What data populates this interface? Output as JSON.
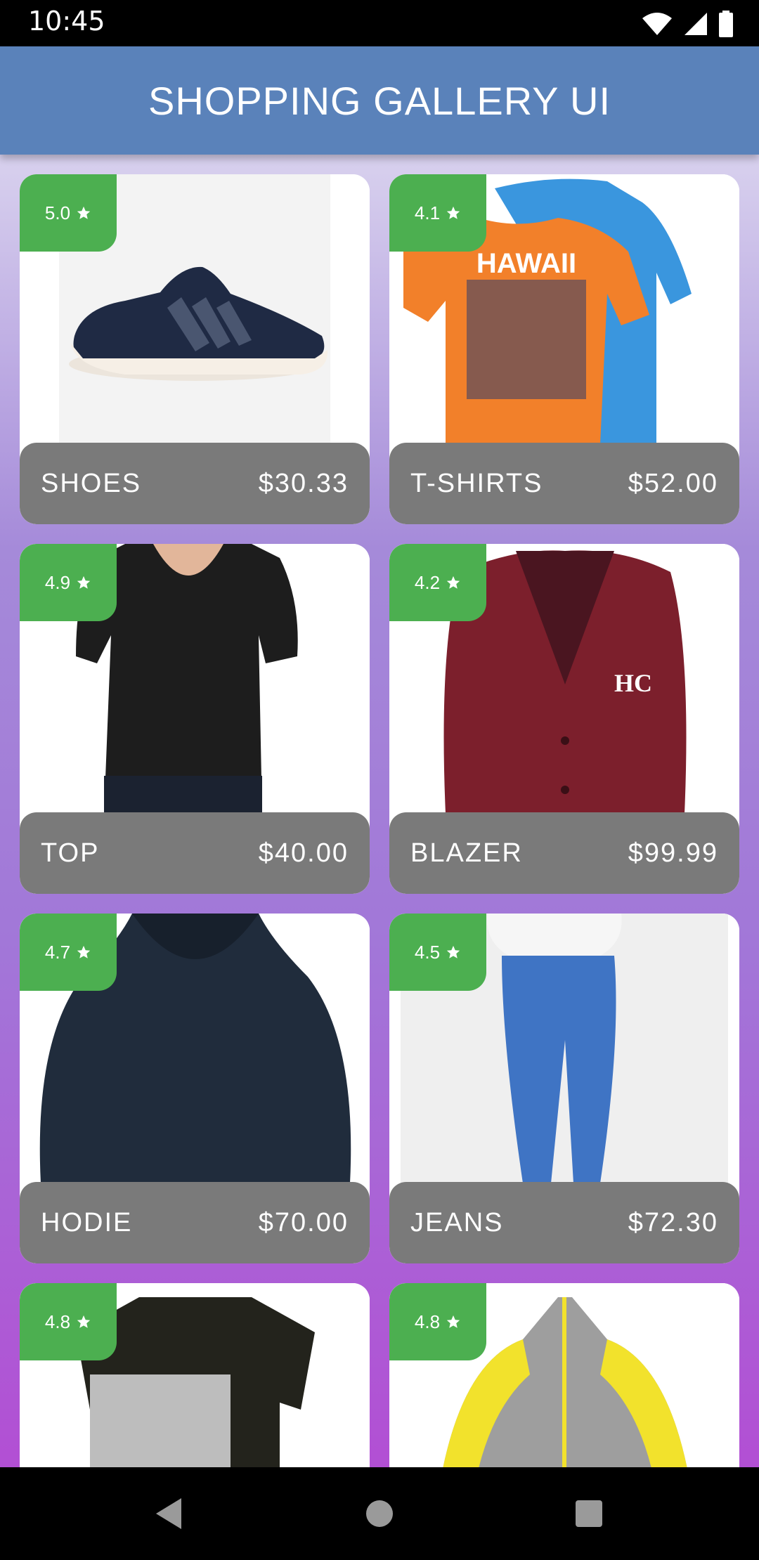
{
  "status": {
    "time": "10:45"
  },
  "appbar": {
    "title": "SHOPPING GALLERY UI"
  },
  "products": [
    {
      "name": "SHOES",
      "price": "$30.33",
      "rating": "5.0",
      "icon": "sneaker-image"
    },
    {
      "name": "T-SHIRTS",
      "price": "$52.00",
      "rating": "4.1",
      "icon": "tshirts-image"
    },
    {
      "name": "TOP",
      "price": "$40.00",
      "rating": "4.9",
      "icon": "black-top-image"
    },
    {
      "name": "BLAZER",
      "price": "$99.99",
      "rating": "4.2",
      "icon": "maroon-blazer-image"
    },
    {
      "name": "HODIE",
      "price": "$70.00",
      "rating": "4.7",
      "icon": "navy-hoodie-image"
    },
    {
      "name": "JEANS",
      "price": "$72.30",
      "rating": "4.5",
      "icon": "blue-jeans-image"
    },
    {
      "name": "",
      "price": "",
      "rating": "4.8",
      "icon": "black-tshirt-shorts-image"
    },
    {
      "name": "",
      "price": "",
      "rating": "4.8",
      "icon": "grey-yellow-jacket-image"
    }
  ],
  "colors": {
    "appbar": "#5a82ba",
    "rating_badge": "#4caf50",
    "info_bar": "#7a7a7a"
  }
}
